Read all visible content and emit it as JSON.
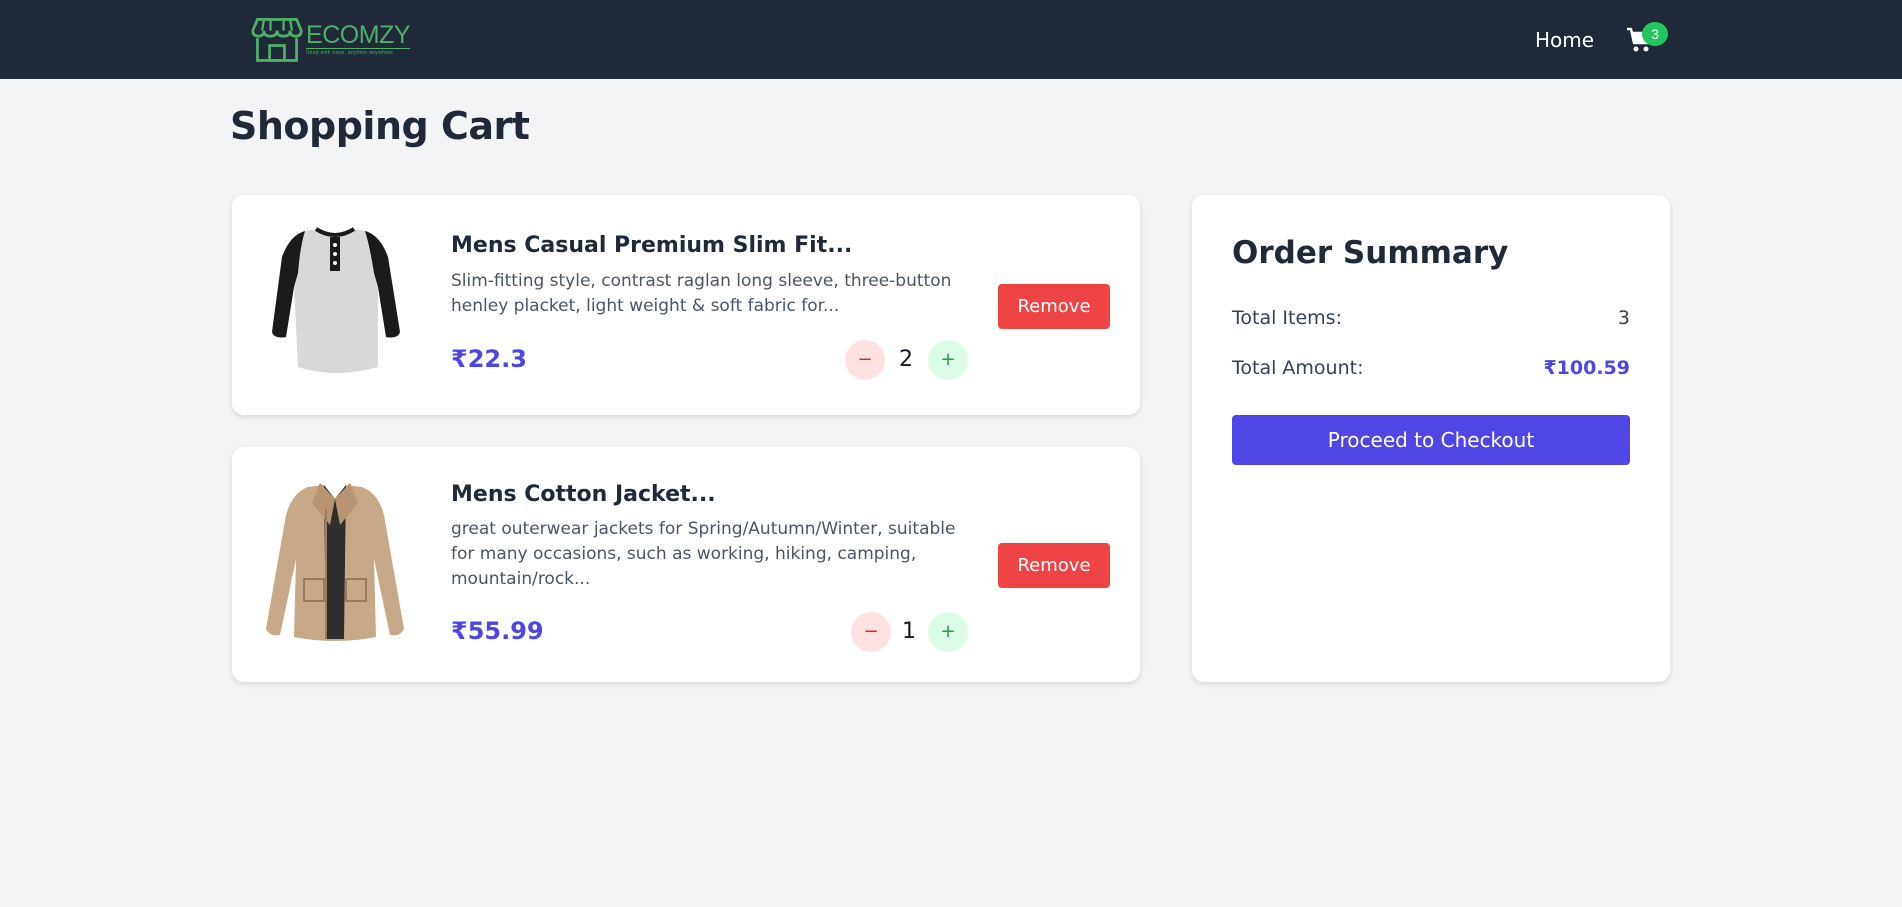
{
  "navbar": {
    "logo_text": "ECOMZY",
    "logo_tagline": "Shop with ease, anytime anywhere",
    "home_label": "Home",
    "cart_count": "3"
  },
  "page_title": "Shopping Cart",
  "cart_items": [
    {
      "title": "Mens Casual Premium Slim Fit...",
      "description": "Slim-fitting style, contrast raglan long sleeve, three-button henley placket, light weight & soft fabric for...",
      "price": "₹22.3",
      "quantity": "2",
      "decrement_label": "−",
      "increment_label": "+",
      "remove_label": "Remove"
    },
    {
      "title": "Mens Cotton Jacket...",
      "description": "great outerwear jackets for Spring/Autumn/Winter, suitable for many occasions, such as working, hiking, camping, mountain/rock...",
      "price": "₹55.99",
      "quantity": "1",
      "decrement_label": "−",
      "increment_label": "+",
      "remove_label": "Remove"
    }
  ],
  "summary": {
    "title": "Order Summary",
    "total_items_label": "Total Items:",
    "total_items_value": "3",
    "total_amount_label": "Total Amount:",
    "total_amount_value": "₹100.59",
    "checkout_label": "Proceed to Checkout"
  },
  "colors": {
    "navbar_bg": "#1f2937",
    "brand_green": "#4caf6a",
    "badge_green": "#22c55e",
    "price_indigo": "#4f46e5",
    "remove_red": "#ef4444",
    "page_bg": "#f3f4f6"
  },
  "icons": {
    "logo": "store-icon",
    "cart": "cart-icon"
  }
}
